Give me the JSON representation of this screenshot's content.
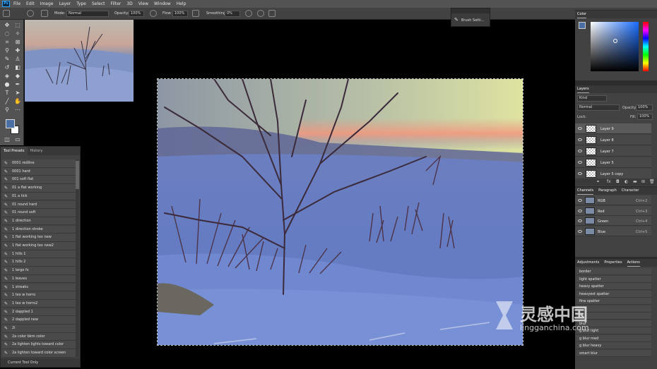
{
  "menubar": {
    "logo": "Ps",
    "items": [
      "File",
      "Edit",
      "Image",
      "Layer",
      "Type",
      "Select",
      "Filter",
      "3D",
      "View",
      "Window",
      "Help"
    ]
  },
  "options": {
    "mode_label": "Mode:",
    "mode_value": "Normal",
    "opacity_label": "Opacity:",
    "opacity_value": "100%",
    "flow_label": "Flow:",
    "flow_value": "100%",
    "smoothing_label": "Smoothing:",
    "smoothing_value": "0%"
  },
  "brush_settings": {
    "label": "Brush Setti..."
  },
  "tool_presets": {
    "tabs": [
      "Tool Presets",
      "History"
    ],
    "items": [
      "0001 redline",
      "0001 hard",
      "001 soft flat",
      "01 a flat working",
      "01 a tick",
      "01 round hard",
      "01 round soft",
      "1 direction",
      "1 direction stroke",
      "1 flat working tex new",
      "1 flat working tex new2",
      "1 hills 1",
      "1 hills 2",
      "1 large fx",
      "1 leaves",
      "1 streaks",
      "1 tex w horro",
      "1 tex w horro2",
      "2 dappled 1",
      "2 dappled new",
      "2i",
      "2a color bkm color",
      "2a lighten lights toward color",
      "2a lighten toward color screen"
    ],
    "footer": "Current Tool Only"
  },
  "color_panel": {
    "title": "Color"
  },
  "layers_panel": {
    "title": "Layers",
    "kind_label": "Kind",
    "blend_mode": "Normal",
    "opacity_label": "Opacity:",
    "opacity_value": "100%",
    "lock_label": "Lock:",
    "fill_label": "Fill:",
    "fill_value": "100%",
    "layers": [
      "Layer 9",
      "Layer 8",
      "Layer 7",
      "Layer 5",
      "Layer 5 copy"
    ]
  },
  "channels_panel": {
    "tabs": [
      "Channels",
      "Paragraph",
      "Character"
    ],
    "channels": [
      {
        "name": "RGB",
        "key": "Ctrl+2"
      },
      {
        "name": "Red",
        "key": "Ctrl+3"
      },
      {
        "name": "Green",
        "key": "Ctrl+4"
      },
      {
        "name": "Blue",
        "key": "Ctrl+5"
      }
    ]
  },
  "actions_panel": {
    "tabs": [
      "Adjustments",
      "Properties",
      "Actions"
    ],
    "items": [
      "border",
      "light spatter",
      "heavy spatter",
      "heavyest spatter",
      "fine spatter",
      "",
      "",
      "blur",
      "g blur light",
      "g blur med",
      "g blur heavy",
      "smart blur"
    ]
  },
  "watermark": {
    "cn": "灵感中国",
    "en": "lingganchina.com"
  },
  "colors": {
    "foreground": "#4a6fa5",
    "background": "#ffffff",
    "accent": "#31a8ff"
  }
}
